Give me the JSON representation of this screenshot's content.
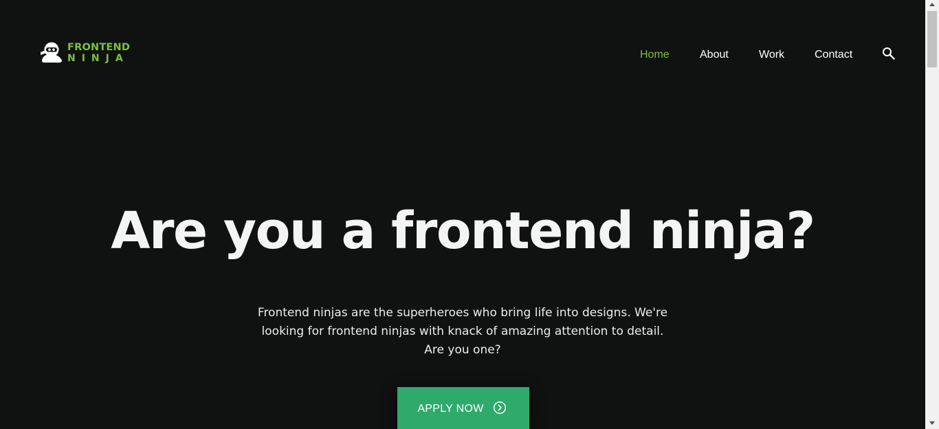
{
  "header": {
    "logo_line1": "FRONTEND",
    "logo_line2": "NINJA",
    "logo_icon": "ninja-icon",
    "nav": [
      "Home",
      "About",
      "Work",
      "Contact"
    ],
    "active_nav": "Home",
    "search_icon": "search-icon"
  },
  "hero": {
    "title": "Are you a frontend ninja?",
    "description_lines": [
      "Frontend ninjas are the superheroes who bring life into designs. We're",
      "looking for frontend ninjas with knack of amazing attention to detail.",
      "Are you one?"
    ],
    "cta_label": "APPLY NOW",
    "cta_icon": "chevron-right-circle-icon"
  },
  "colors": {
    "background": "#101212",
    "accent": "#7dc13b",
    "button": "#2eaa6b",
    "text": "#ffffff"
  }
}
